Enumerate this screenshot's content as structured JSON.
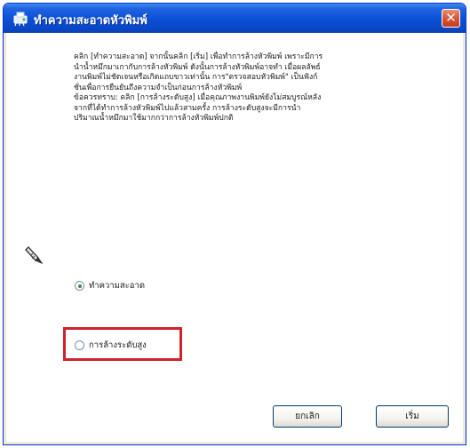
{
  "window": {
    "title": "ทำความสะอาดหัวพิมพ์",
    "close_glyph": "✕"
  },
  "instructions": {
    "lines": [
      "คลิก [ทำความสะอาด] จากนั้นคลิก [เริ่ม] เพื่อทำการล้างหัวพิมพ์ เพราะมีการ",
      "นำน้ำหมึกมาเกากับการล้างหัวพิมพ์ ดังนั้นการล้างหัวพิมพ์อาจทำ เมื่อผลลัพธ์",
      "งานพิมพ์ไม่ชัดเจนหรือเกิดแถบขาวเท่านั้น การ\"ตรวจสอบหัวพิมพ์\" เป็นฟังก์",
      "ชั่นเพื่อการยืนยันถึงความจำเป็นก่อนการล้างหัวพิมพ์",
      "ข้อควรทราบ: คลิก [การล้างระดับสูง] เมื่อคุณภาพงานพิมพ์ยังไม่สมบูรณ์หลัง",
      "จากที่ได้ทำการล้างหัวพิมพ์ไปแล้วสามครั้ง การล้างระดับสูงจะมีการนำ",
      "ปริมาณน้ำหมึกมาใช้มากกว่าการล้างหัวพิมพ์ปกติ"
    ]
  },
  "options": {
    "clean_label": "ทำความสะอาด",
    "clean_selected": true,
    "power_label": "การล้างระดับสูง",
    "power_selected": false
  },
  "buttons": {
    "cancel_label": "ยกเลิก",
    "start_label": "เริ่ม"
  },
  "colors": {
    "titlebar": "#0a4fd6",
    "dialog_background": "#ece9d8",
    "highlight_border": "#d3202b",
    "close_button": "#d9563a"
  },
  "icons": {
    "title_icon": "printer-head-icon",
    "section_icon": "nozzle-pen-icon",
    "close_icon": "close-icon"
  }
}
